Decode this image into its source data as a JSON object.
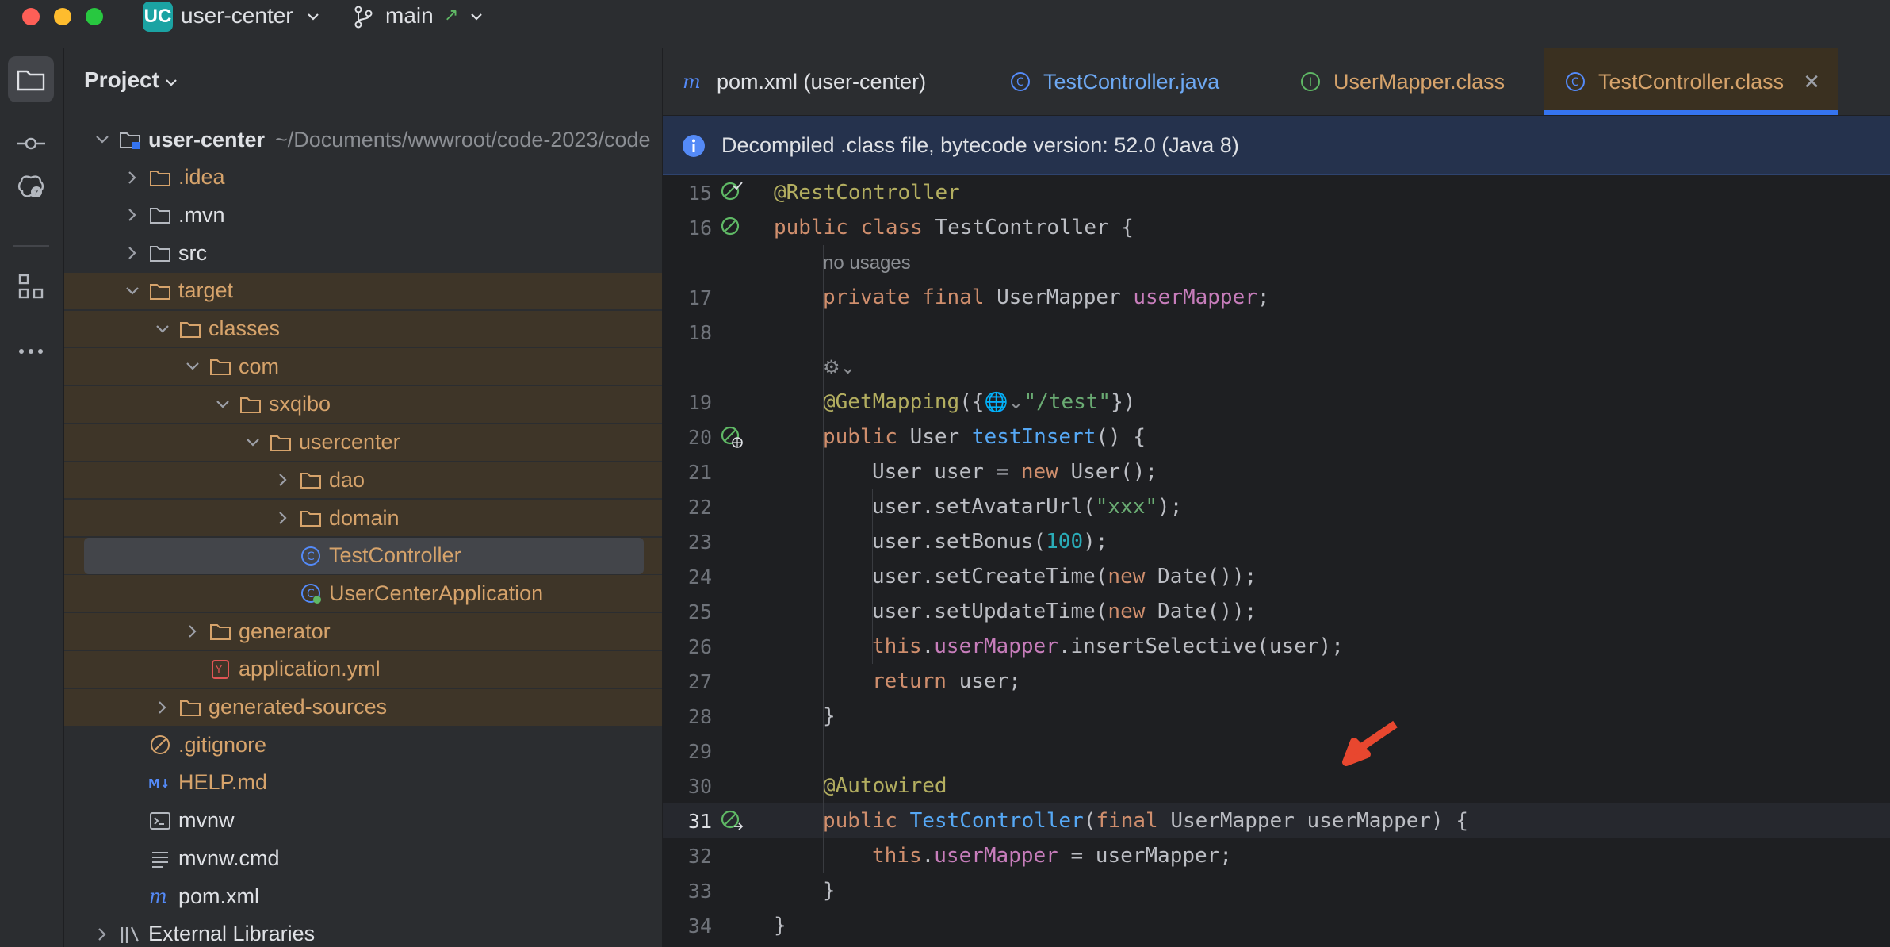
{
  "titlebar": {
    "project_badge": "UC",
    "project_name": "user-center",
    "branch": "main",
    "branch_icon": "git-branch-icon",
    "colors": {
      "close": "#fe5f57",
      "minimize": "#febc2e",
      "maximize": "#28c840"
    }
  },
  "sidebar_icons": [
    "project-folder-icon",
    "commit-icon",
    "ai-assistant-icon",
    "structure-icon",
    "more-icon"
  ],
  "project_panel": {
    "title": "Project",
    "tree": [
      {
        "label": "user-center",
        "path": "~/Documents/wwwroot/code-2023/code",
        "depth": 0,
        "expanded": true,
        "icon": "module-folder-icon",
        "style": "bold"
      },
      {
        "label": ".idea",
        "depth": 1,
        "expanded": false,
        "icon": "folder-icon",
        "style": "orange"
      },
      {
        "label": ".mvn",
        "depth": 1,
        "expanded": false,
        "icon": "folder-icon",
        "style": "plain"
      },
      {
        "label": "src",
        "depth": 1,
        "expanded": false,
        "icon": "folder-icon",
        "style": "plain"
      },
      {
        "label": "target",
        "depth": 1,
        "expanded": true,
        "icon": "folder-icon",
        "style": "orange"
      },
      {
        "label": "classes",
        "depth": 2,
        "expanded": true,
        "icon": "folder-icon",
        "style": "orange"
      },
      {
        "label": "com",
        "depth": 3,
        "expanded": true,
        "icon": "folder-icon",
        "style": "orange"
      },
      {
        "label": "sxqibo",
        "depth": 4,
        "expanded": true,
        "icon": "folder-icon",
        "style": "orange"
      },
      {
        "label": "usercenter",
        "depth": 5,
        "expanded": true,
        "icon": "folder-icon",
        "style": "orange"
      },
      {
        "label": "dao",
        "depth": 6,
        "expanded": false,
        "icon": "folder-icon",
        "style": "orange"
      },
      {
        "label": "domain",
        "depth": 6,
        "expanded": false,
        "icon": "folder-icon",
        "style": "orange"
      },
      {
        "label": "TestController",
        "depth": 6,
        "icon": "class-icon",
        "style": "orange",
        "selected": true
      },
      {
        "label": "UserCenterApplication",
        "depth": 6,
        "icon": "spring-class-icon",
        "style": "orange"
      },
      {
        "label": "generator",
        "depth": 3,
        "expanded": false,
        "icon": "folder-icon",
        "style": "orange"
      },
      {
        "label": "application.yml",
        "depth": 3,
        "icon": "yaml-icon",
        "style": "orange"
      },
      {
        "label": "generated-sources",
        "depth": 2,
        "expanded": false,
        "icon": "folder-icon",
        "style": "orange"
      },
      {
        "label": ".gitignore",
        "depth": 1,
        "icon": "ignore-file-icon",
        "style": "orange"
      },
      {
        "label": "HELP.md",
        "depth": 1,
        "icon": "markdown-icon",
        "style": "orange"
      },
      {
        "label": "mvnw",
        "depth": 1,
        "icon": "terminal-file-icon",
        "style": "plain"
      },
      {
        "label": "mvnw.cmd",
        "depth": 1,
        "icon": "text-file-icon",
        "style": "plain"
      },
      {
        "label": "pom.xml",
        "depth": 1,
        "icon": "maven-icon",
        "style": "plain"
      },
      {
        "label": "External Libraries",
        "depth": 0,
        "expanded": false,
        "icon": "library-icon",
        "style": "plain"
      }
    ]
  },
  "tabs": [
    {
      "label": "pom.xml (user-center)",
      "icon": "maven-icon",
      "color": "#dfe1e5"
    },
    {
      "label": "TestController.java",
      "icon": "class-icon",
      "color": "#6da8f2"
    },
    {
      "label": "UserMapper.class",
      "icon": "interface-icon",
      "color": "#d6a36b"
    },
    {
      "label": "TestController.class",
      "icon": "class-icon",
      "color": "#d6a36b",
      "active": true,
      "closable": true
    }
  ],
  "banner": {
    "icon": "info-icon",
    "text": "Decompiled .class file, bytecode version: 52.0 (Java 8)"
  },
  "editor": {
    "current_line": "31",
    "lines": [
      {
        "n": "15",
        "gutter": "bean-check-icon",
        "tokens": [
          [
            "an",
            "@RestController"
          ]
        ]
      },
      {
        "n": "16",
        "gutter": "bean-icon",
        "tokens": [
          [
            "kw",
            "public class "
          ],
          [
            "",
            "TestController {"
          ]
        ]
      },
      {
        "n": "",
        "hint": "no usages",
        "indent": 1
      },
      {
        "n": "17",
        "indent": 1,
        "tokens": [
          [
            "kw",
            "private final "
          ],
          [
            "",
            "UserMapper "
          ],
          [
            "fld",
            "userMapper"
          ],
          [
            "",
            ";"
          ]
        ]
      },
      {
        "n": "18",
        "tokens": []
      },
      {
        "n": "",
        "indent": 1,
        "hint_icon": "inlay-endpoint-icon"
      },
      {
        "n": "19",
        "indent": 1,
        "tokens": [
          [
            "an",
            "@GetMapping"
          ],
          [
            "",
            "({"
          ],
          [
            "hint",
            "🌐⌄"
          ],
          [
            "str",
            "\"/test\""
          ],
          [
            "",
            "})"
          ]
        ]
      },
      {
        "n": "20",
        "gutter": "web-endpoint-icon",
        "indent": 1,
        "tokens": [
          [
            "kw",
            "public "
          ],
          [
            "",
            "User "
          ],
          [
            "fn",
            "testInsert"
          ],
          [
            "",
            "() {"
          ]
        ]
      },
      {
        "n": "21",
        "indent": 2,
        "tokens": [
          [
            "",
            "User user = "
          ],
          [
            "kw",
            "new "
          ],
          [
            "",
            "User();"
          ]
        ]
      },
      {
        "n": "22",
        "indent": 2,
        "tokens": [
          [
            "",
            "user.setAvatarUrl("
          ],
          [
            "str",
            "\"xxx\""
          ],
          [
            "",
            ");"
          ]
        ]
      },
      {
        "n": "23",
        "indent": 2,
        "tokens": [
          [
            "",
            "user.setBonus("
          ],
          [
            "num",
            "100"
          ],
          [
            "",
            ");"
          ]
        ]
      },
      {
        "n": "24",
        "indent": 2,
        "tokens": [
          [
            "",
            "user.setCreateTime("
          ],
          [
            "kw",
            "new "
          ],
          [
            "",
            "Date());"
          ]
        ]
      },
      {
        "n": "25",
        "indent": 2,
        "tokens": [
          [
            "",
            "user.setUpdateTime("
          ],
          [
            "kw",
            "new "
          ],
          [
            "",
            "Date());"
          ]
        ]
      },
      {
        "n": "26",
        "indent": 2,
        "tokens": [
          [
            "kw",
            "this"
          ],
          [
            "",
            "."
          ],
          [
            "fld",
            "userMapper"
          ],
          [
            "",
            ".insertSelective(user);"
          ]
        ]
      },
      {
        "n": "27",
        "indent": 2,
        "tokens": [
          [
            "kw",
            "return "
          ],
          [
            "",
            "user;"
          ]
        ]
      },
      {
        "n": "28",
        "indent": 1,
        "tokens": [
          [
            "",
            "}"
          ]
        ]
      },
      {
        "n": "29",
        "tokens": []
      },
      {
        "n": "30",
        "indent": 1,
        "tokens": [
          [
            "an",
            "@Autowired"
          ]
        ]
      },
      {
        "n": "31",
        "gutter": "bean-autowire-icon",
        "indent": 1,
        "tokens": [
          [
            "kw",
            "public "
          ],
          [
            "fn",
            "TestController"
          ],
          [
            "",
            "("
          ],
          [
            "kw",
            "final "
          ],
          [
            "",
            "UserMapper userMapper) {"
          ]
        ]
      },
      {
        "n": "32",
        "indent": 2,
        "tokens": [
          [
            "kw",
            "this"
          ],
          [
            "",
            "."
          ],
          [
            "fld",
            "userMapper"
          ],
          [
            "",
            " = userMapper;"
          ]
        ]
      },
      {
        "n": "33",
        "indent": 1,
        "tokens": [
          [
            "",
            "}"
          ]
        ]
      },
      {
        "n": "34",
        "tokens": [
          [
            "",
            "}"
          ]
        ]
      }
    ]
  },
  "annotation": {
    "icon": "red-arrow-icon",
    "color": "#e8472f"
  }
}
